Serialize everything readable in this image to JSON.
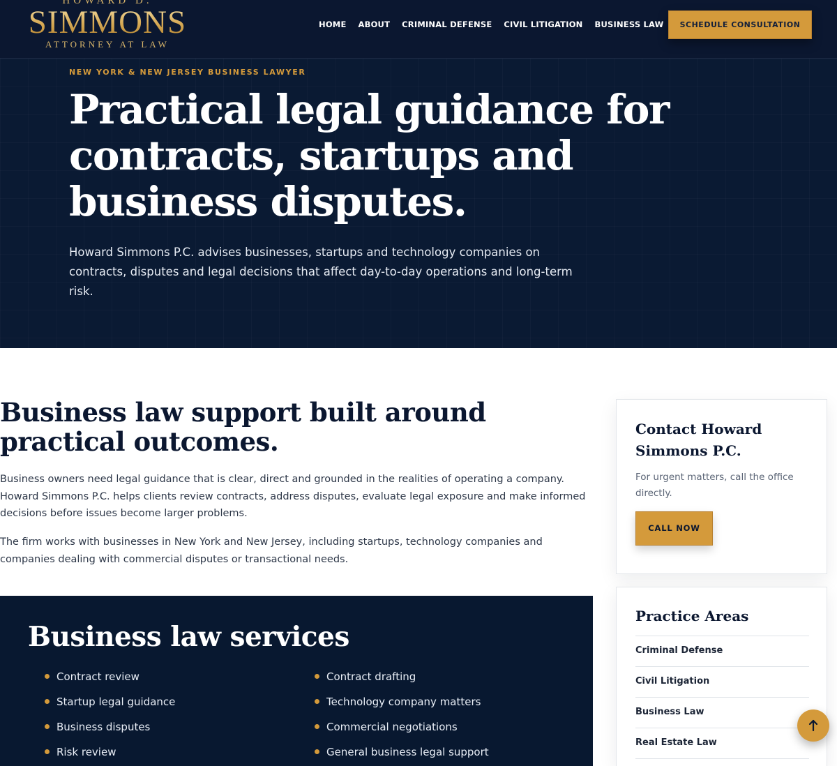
{
  "header": {
    "logo": {
      "top": "HOWARD D.",
      "main": "SIMMONS",
      "sub": "ATTORNEY AT LAW"
    },
    "nav": [
      "HOME",
      "ABOUT",
      "CRIMINAL DEFENSE",
      "CIVIL LITIGATION",
      "BUSINESS LAW"
    ],
    "cta_label": "SCHEDULE CONSULTATION"
  },
  "hero": {
    "eyebrow": "NEW YORK & NEW JERSEY BUSINESS LAWYER",
    "title": "Practical legal guidance for contracts, startups and business disputes.",
    "lede": "Howard Simmons P.C. advises businesses, startups and technology companies on contracts, disputes and legal decisions that affect day-to-day operations and long-term risk."
  },
  "main": {
    "title": "Business law support built around practical outcomes.",
    "paragraphs": [
      "Business owners need legal guidance that is clear, direct and grounded in the realities of operating a company. Howard Simmons P.C. helps clients review contracts, address disputes, evaluate legal exposure and make informed decisions before issues become larger problems.",
      "The firm works with businesses in New York and New Jersey, including startups, technology companies and companies dealing with commercial disputes or transactional needs."
    ],
    "services": {
      "title": "Business law services",
      "col1": [
        "Contract review",
        "Startup legal guidance",
        "Business disputes",
        "Risk review"
      ],
      "col2": [
        "Contract drafting",
        "Technology company matters",
        "Commercial negotiations",
        "General business legal support"
      ]
    }
  },
  "sidebar": {
    "contact": {
      "title": "Contact Howard Simmons P.C.",
      "text": "For urgent matters, call the office directly.",
      "button": "CALL NOW"
    },
    "practice": {
      "title": "Practice Areas",
      "items": [
        "Criminal Defense",
        "Civil Litigation",
        "Business Law",
        "Real Estate Law"
      ]
    }
  },
  "scroll_top": {
    "icon": "arrow-up-icon"
  },
  "colors": {
    "navy": "#0b1730",
    "gold": "#d49a3b",
    "text": "#2d3748"
  }
}
